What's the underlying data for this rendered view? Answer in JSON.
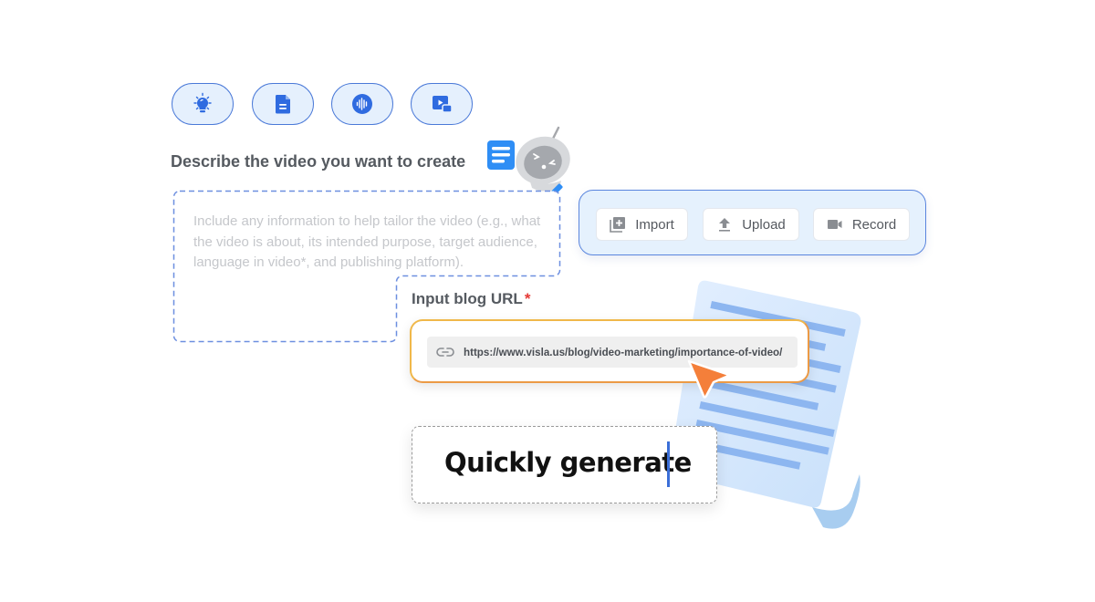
{
  "mode_pills": [
    {
      "icon": "lightbulb-icon",
      "label": "Idea"
    },
    {
      "icon": "document-icon",
      "label": "Script"
    },
    {
      "icon": "audio-icon",
      "label": "Audio"
    },
    {
      "icon": "video-icon",
      "label": "Video"
    }
  ],
  "describe": {
    "heading": "Describe the video you want to create",
    "placeholder": "Include any information to help tailor the video (e.g., what the video is about,  its intended purpose, target audience, language in video*, and publishing platform)."
  },
  "import_panel": {
    "buttons": [
      {
        "label": "Import",
        "icon": "import-icon"
      },
      {
        "label": "Upload",
        "icon": "upload-icon"
      },
      {
        "label": "Record",
        "icon": "camera-icon"
      }
    ]
  },
  "blog_url": {
    "label": "Input blog URL",
    "required_mark": "*",
    "value": "https://www.visla.us/blog/video-marketing/importance-of-video/"
  },
  "generate": {
    "text": "Quickly generate"
  },
  "colors": {
    "accent_blue": "#4a79d8",
    "pill_bg": "#e5f0fd",
    "url_border": "#f0b84a",
    "cursor_orange": "#f47f3a",
    "required_red": "#e53935"
  }
}
